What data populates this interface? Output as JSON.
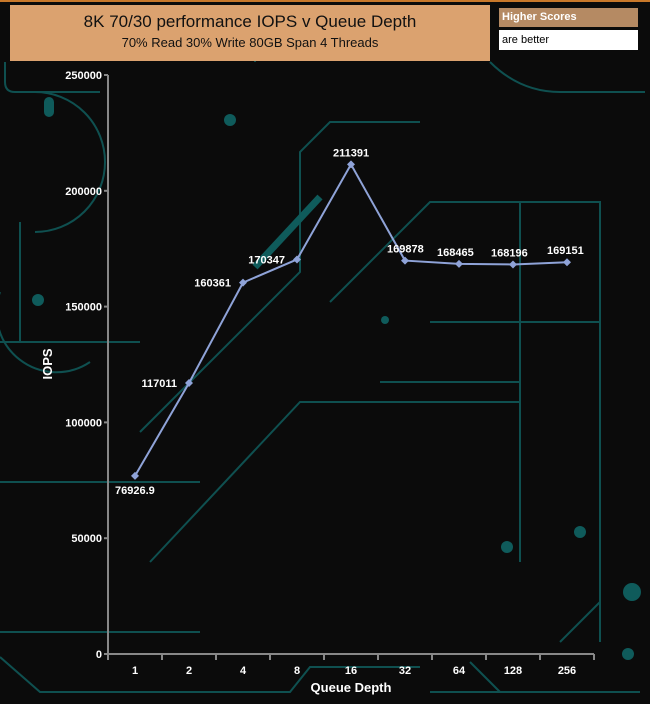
{
  "header": {
    "title": "8K 70/30 performance IOPS v Queue Depth",
    "subtitle": "70% Read 30% Write 80GB Span 4 Threads"
  },
  "legend": {
    "line1": "Higher Scores",
    "line2": "are better"
  },
  "colors": {
    "line": "#8fa3d8",
    "circuit": "#0f5b5b",
    "title_bg": "#dba26f"
  },
  "chart_data": {
    "type": "line",
    "title": "8K 70/30 performance IOPS v Queue Depth",
    "subtitle": "70% Read 30% Write 80GB Span 4 Threads",
    "xlabel": "Queue Depth",
    "ylabel": "IOPS",
    "categories": [
      "1",
      "2",
      "4",
      "8",
      "16",
      "32",
      "64",
      "128",
      "256"
    ],
    "series": [
      {
        "name": "IOPS",
        "values": [
          76926.9,
          117011,
          160361,
          170347,
          211391,
          169878,
          168465,
          168196,
          169151
        ]
      }
    ],
    "data_labels": [
      "76926.9",
      "117011",
      "160361",
      "170347",
      "211391",
      "169878",
      "168465",
      "168196",
      "169151"
    ],
    "ylim": [
      0,
      250000
    ],
    "yticks": [
      "0",
      "50000",
      "100000",
      "150000",
      "200000",
      "250000"
    ],
    "grid": false
  }
}
